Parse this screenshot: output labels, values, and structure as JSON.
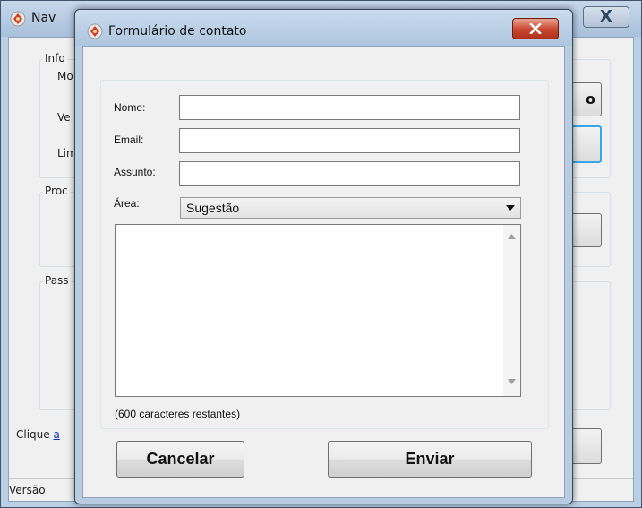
{
  "background_window": {
    "title": "Nav",
    "close_glyph": "X",
    "group_info_label": "Info",
    "label_mo": "Mo",
    "label_ve": "Ve",
    "label_lim": "Lim",
    "group_proc_label": "Proc",
    "group_pass_label": "Pass",
    "button_partial_label": "o",
    "status_prefix": "Clique",
    "status_link": "a",
    "version_label": "Versão"
  },
  "dialog": {
    "title": "Formulário de contato",
    "fields": {
      "name_label": "Nome:",
      "name_value": "",
      "email_label": "Email:",
      "email_value": "",
      "subject_label": "Assunto:",
      "subject_value": "",
      "area_label": "Área:",
      "area_selected": "Sugestão",
      "message_value": ""
    },
    "remaining_text": "(600 caracteres restantes)",
    "cancel_label": "Cancelar",
    "send_label": "Enviar"
  },
  "icons": {
    "app": "app-logo-icon",
    "close": "close-icon",
    "dropdown": "chevron-down-icon",
    "scroll_up": "scroll-up-icon",
    "scroll_down": "scroll-down-icon"
  },
  "colors": {
    "close_button": "#c9452e",
    "window_frame": "#b8cde2",
    "link": "#0033cc"
  }
}
